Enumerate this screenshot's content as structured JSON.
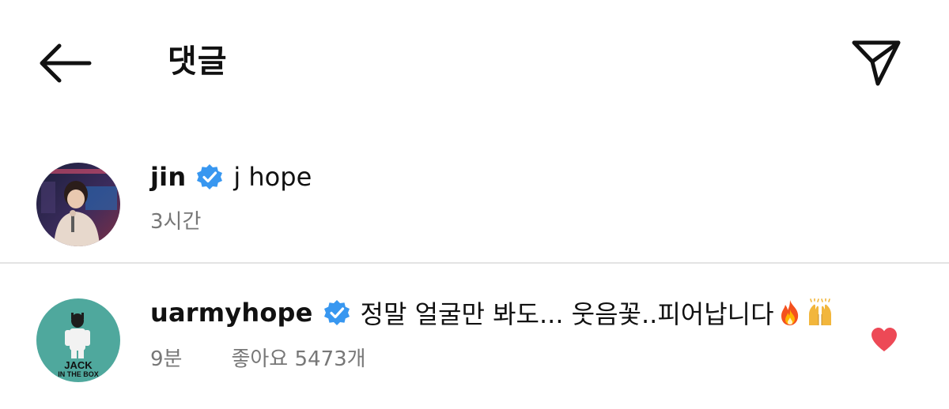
{
  "header": {
    "title": "댓글",
    "back_icon": "arrow-left-icon",
    "send_icon": "paper-plane-icon"
  },
  "caption": {
    "username": "jin",
    "verified": true,
    "text": "j hope",
    "time": "3시간"
  },
  "comment": {
    "username": "uarmyhope",
    "verified": true,
    "text": "정말 얼굴만 봐도... 웃음꽃..피어납니다",
    "emojis": [
      "fire-emoji",
      "raising-hands-emoji"
    ],
    "time": "9분",
    "likes": "좋아요 5473개",
    "liked": true,
    "avatar_text": [
      "JACK",
      "IN",
      "THE",
      "BOX"
    ]
  },
  "colors": {
    "verified_blue": "#3897f0",
    "heart_red": "#ed4956",
    "meta_gray": "#777777",
    "avatar_teal": "#4fa89d"
  }
}
